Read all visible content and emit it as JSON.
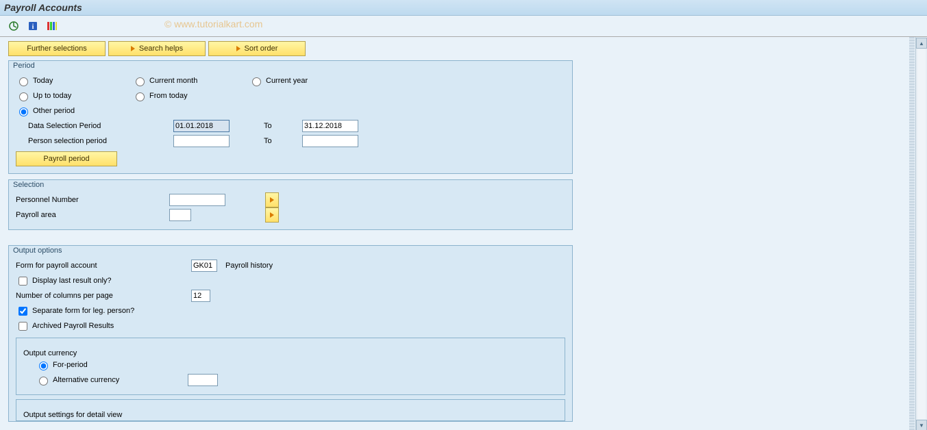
{
  "title": "Payroll Accounts",
  "watermark": "© www.tutorialkart.com",
  "topButtons": {
    "further": "Further selections",
    "searchHelps": "Search helps",
    "sortOrder": "Sort order"
  },
  "period": {
    "legend": "Period",
    "radios": {
      "today": "Today",
      "currentMonth": "Current month",
      "currentYear": "Current year",
      "upToToday": "Up to today",
      "fromToday": "From today",
      "other": "Other period"
    },
    "dataSelLabel": "Data Selection Period",
    "dataSelFrom": "01.01.2018",
    "dataSelTo": "31.12.2018",
    "toLabel": "To",
    "personSelLabel": "Person selection period",
    "personSelFrom": "",
    "personSelTo": "",
    "payrollPeriodBtn": "Payroll period"
  },
  "selection": {
    "legend": "Selection",
    "personnelNumberLabel": "Personnel Number",
    "personnelNumberValue": "",
    "payrollAreaLabel": "Payroll area",
    "payrollAreaValue": ""
  },
  "output": {
    "legend": "Output options",
    "formLabel": "Form for payroll account",
    "formCode": "GK01",
    "formDesc": "Payroll history",
    "displayLastLabel": "Display last result only?",
    "displayLastChecked": false,
    "numColsLabel": "Number of columns per page",
    "numColsValue": "12",
    "separateFormLabel": "Separate form for leg. person?",
    "separateFormChecked": true,
    "archivedLabel": "Archived Payroll Results",
    "archivedChecked": false,
    "currency": {
      "legend": "Output currency",
      "forPeriod": "For-period",
      "alternative": "Alternative currency",
      "alternativeValue": ""
    },
    "detailViewLegend": "Output settings for detail view"
  }
}
